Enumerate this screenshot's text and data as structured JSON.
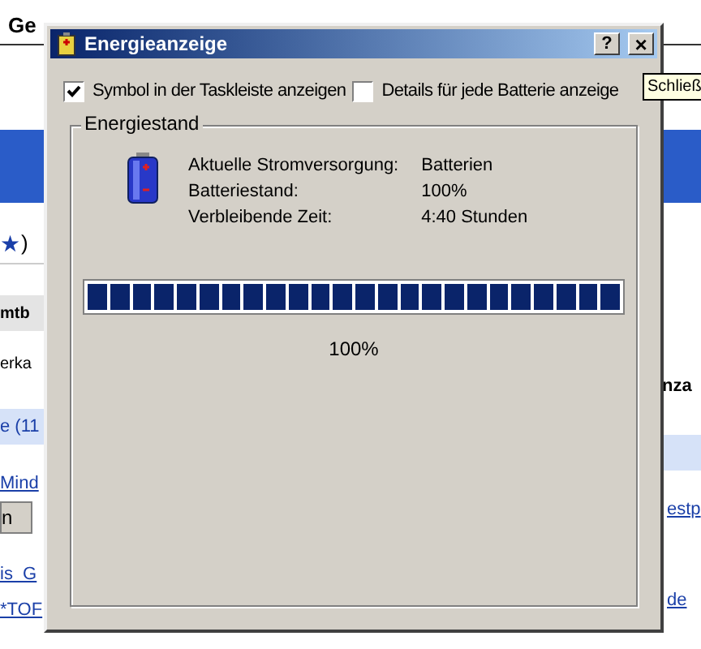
{
  "background_page": {
    "menu_fragment": "Ge",
    "left_fragments": [
      {
        "kind": "star",
        "icon": "★",
        "text": ")"
      },
      {
        "kind": "header",
        "text": "mtb"
      },
      {
        "kind": "plain",
        "text": "erka"
      },
      {
        "kind": "highlight",
        "text": "e (11"
      },
      {
        "kind": "link",
        "text": "Mind"
      },
      {
        "kind": "button",
        "text": "n"
      },
      {
        "kind": "link",
        "text": "is  G"
      },
      {
        "kind": "link",
        "text": "*TOF"
      }
    ],
    "right_fragments": [
      {
        "kind": "header",
        "text": "nza"
      },
      {
        "kind": "link",
        "text": "estp"
      },
      {
        "kind": "link",
        "text": "de"
      }
    ]
  },
  "dialog": {
    "title": "Energieanzeige",
    "help_button": "?",
    "close_button": "×",
    "options": [
      {
        "label": "Symbol in der Taskleiste anzeigen",
        "checked": true
      },
      {
        "label": "Details für jede Batterie anzeige",
        "checked": false
      }
    ],
    "tooltip": "Schließ",
    "group": {
      "title": "Energiestand",
      "details": [
        {
          "label": "Aktuelle Stromversorgung:",
          "value": "Batterien"
        },
        {
          "label": "Batteriestand:",
          "value": "100%"
        },
        {
          "label": "Verbleibende Zeit:",
          "value": "4:40 Stunden"
        }
      ],
      "battery": {
        "level": 1.0
      },
      "percent": "100%"
    }
  }
}
